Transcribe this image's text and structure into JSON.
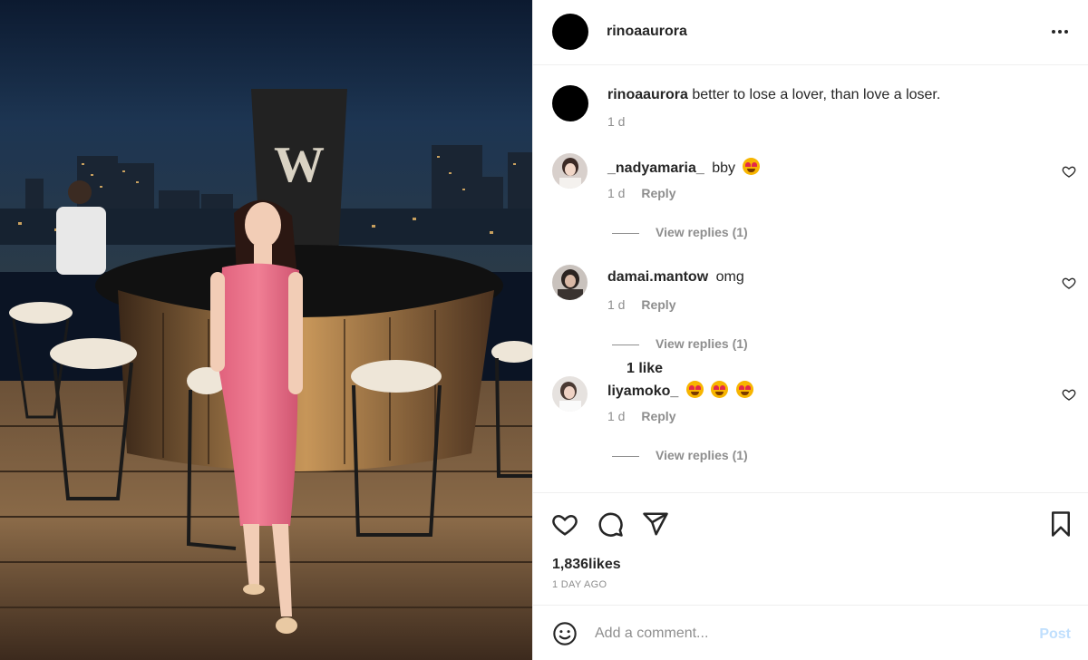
{
  "post": {
    "username": "rinoaaurora",
    "image_alt": "photo",
    "caption": {
      "username": "rinoaaurora",
      "text": "better to lose a lover, than love a loser.",
      "time": "1 d"
    }
  },
  "comments": [
    {
      "username": "_nadyamaria_",
      "text": "bby",
      "emoji_count": 1,
      "time": "1 d",
      "likes_label": "",
      "reply_label": "Reply",
      "view_replies": "View replies (1)"
    },
    {
      "username": "damai.mantow",
      "text": "omg",
      "emoji_count": 0,
      "time": "1 d",
      "likes_label": "1 like",
      "reply_label": "Reply",
      "view_replies": "View replies (1)"
    },
    {
      "username": "liyamoko_",
      "text": "",
      "emoji_count": 3,
      "time": "1 d",
      "likes_label": "",
      "reply_label": "Reply",
      "view_replies": "View replies (1)"
    }
  ],
  "actions": {
    "likes": "1,836likes",
    "date": "1 DAY AGO",
    "icons": [
      "heart-icon",
      "comment-icon",
      "share-icon",
      "bookmark-icon"
    ]
  },
  "add_comment": {
    "placeholder": "Add a comment...",
    "post_label": "Post"
  },
  "colors": {
    "text": "#262626",
    "secondary": "#8e8e8e",
    "post_disabled": "#c0dffd",
    "dress": "#e56f86"
  }
}
